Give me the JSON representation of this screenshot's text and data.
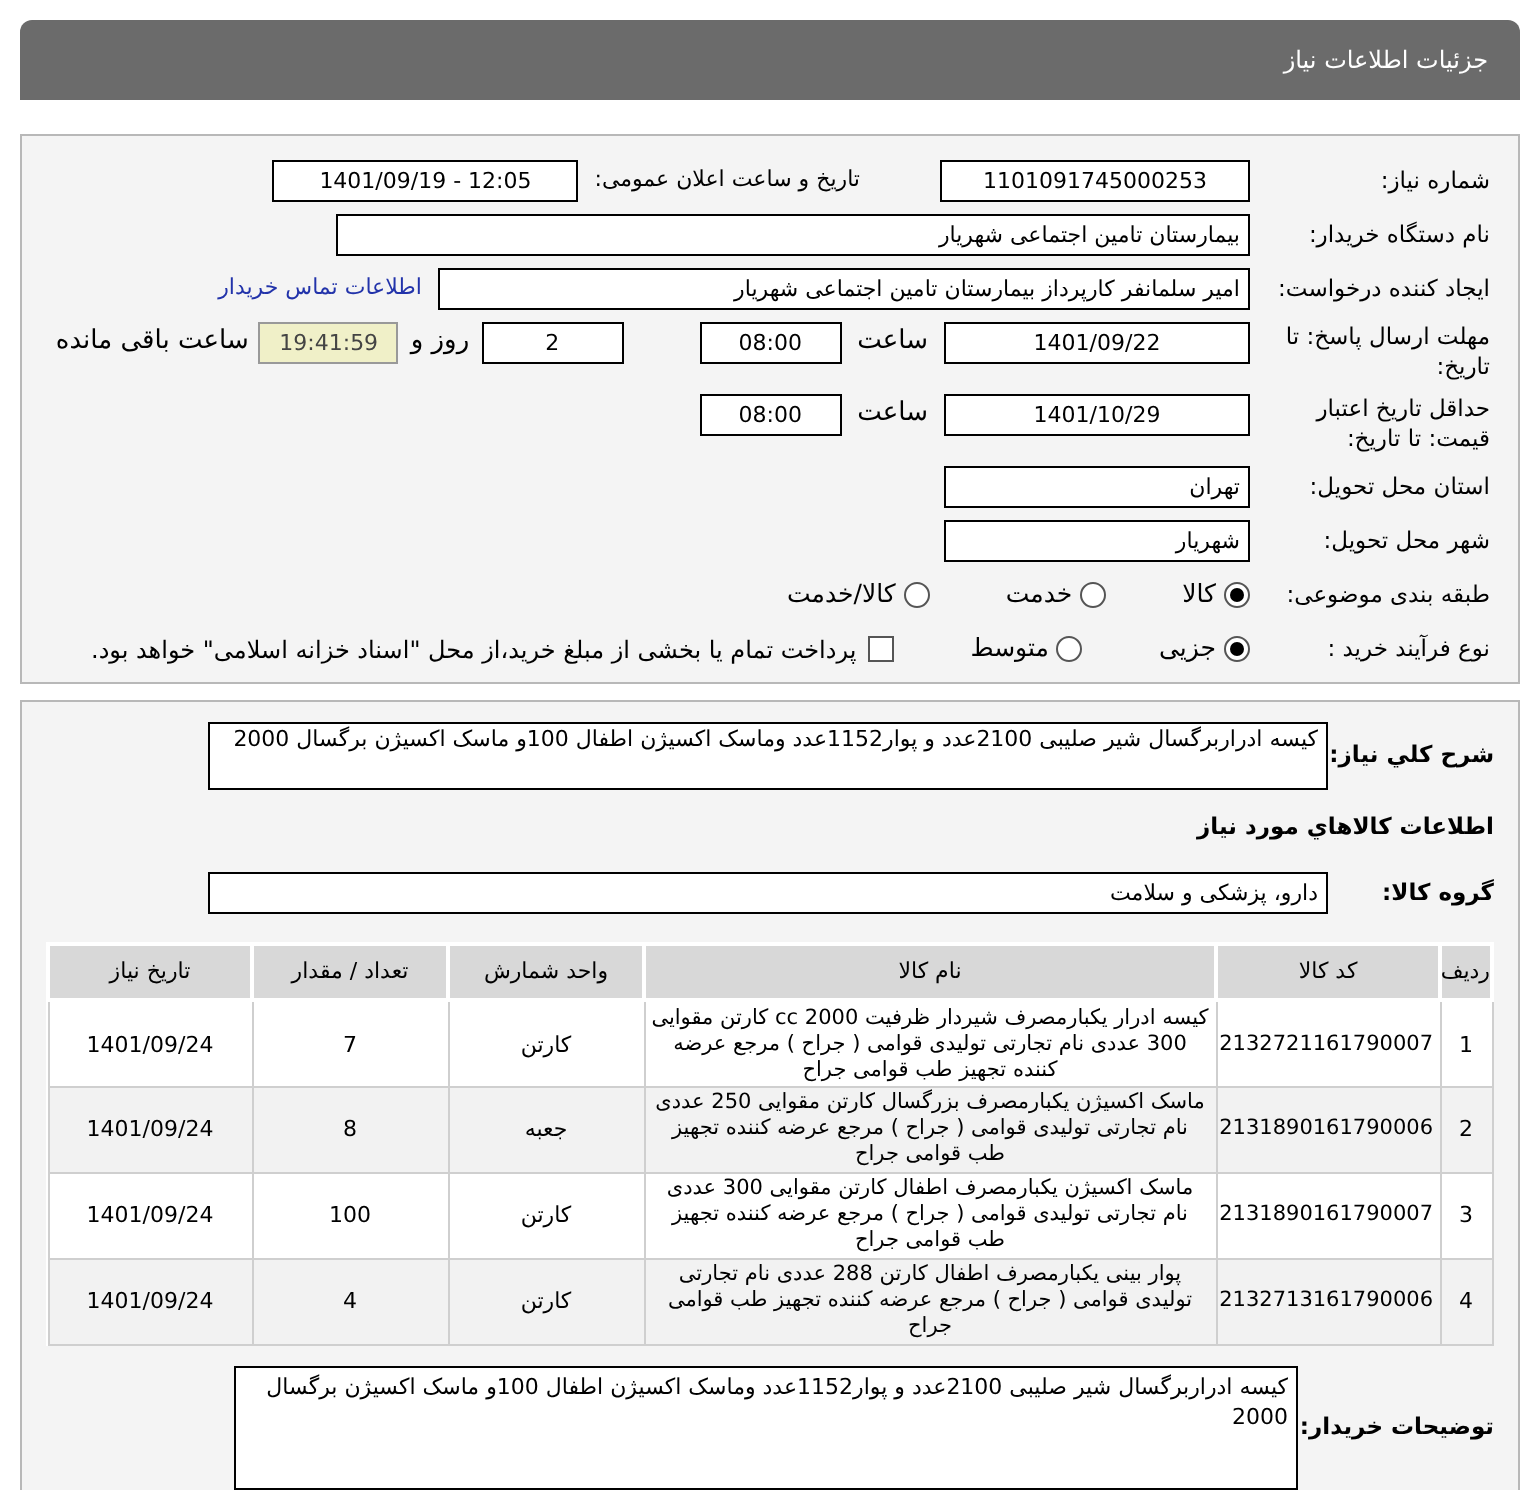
{
  "page_title": "جزئیات اطلاعات نیاز",
  "need_number": {
    "label": "شماره نیاز:",
    "value": "1101091745000253"
  },
  "announce": {
    "label": "تاریخ و ساعت اعلان عمومی:",
    "value": "1401/09/19 - 12:05"
  },
  "buyer_org": {
    "label": "نام دستگاه خریدار:",
    "value": "بیمارستان تامین اجتماعی شهریار"
  },
  "requester": {
    "label": "ایجاد کننده درخواست:",
    "value": "امیر سلمانفر کارپرداز بیمارستان تامین اجتماعی شهریار",
    "link": "اطلاعات تماس خریدار"
  },
  "deadline": {
    "label": "مهلت ارسال پاسخ: تا تاریخ:",
    "date": "1401/09/22",
    "time_label": "ساعت",
    "time": "08:00",
    "days": "2",
    "days_label": "روز و",
    "remaining": "19:41:59",
    "remaining_label": "ساعت باقی مانده"
  },
  "validity": {
    "label": "حداقل تاریخ اعتبار قیمت: تا تاریخ:",
    "date": "1401/10/29",
    "time_label": "ساعت",
    "time": "08:00"
  },
  "province": {
    "label": "استان محل تحویل:",
    "value": "تهران"
  },
  "city": {
    "label": "شهر محل تحویل:",
    "value": "شهریار"
  },
  "category": {
    "label": "طبقه بندی موضوعی:",
    "options": [
      {
        "label": "کالا",
        "selected": true
      },
      {
        "label": "خدمت",
        "selected": false
      },
      {
        "label": "کالا/خدمت",
        "selected": false
      }
    ]
  },
  "process": {
    "label": "نوع فرآیند خرید :",
    "options": [
      {
        "label": "جزیی",
        "selected": true
      },
      {
        "label": "متوسط",
        "selected": false
      }
    ],
    "treasury": {
      "label": "پرداخت تمام یا بخشی از مبلغ خرید،از محل \"اسناد خزانه اسلامی\" خواهد بود.",
      "checked": false
    }
  },
  "description": {
    "label": "شرح کلي نياز:",
    "value": "کیسه ادراربرگسال شیر صلیبی  2100عدد و پوار1152عدد وماسک اکسیژن اطفال 100و ماسک اکسیژن برگسال 2000"
  },
  "goods_heading": "اطلاعات كالاهاي مورد نياز",
  "goods_group": {
    "label": "گروه کالا:",
    "value": "دارو، پزشکی و سلامت"
  },
  "table": {
    "columns": [
      "ردیف",
      "کد کالا",
      "نام کالا",
      "واحد شمارش",
      "تعداد / مقدار",
      "تاریخ نیاز"
    ],
    "rows": [
      [
        "1",
        "2132721161790007",
        "کیسه ادرار یکبارمصرف شیردار ظرفیت cc 2000 کارتن مقوایی 300 عددی نام تجارتی تولیدی قوامی ( جراح ) مرجع عرضه کننده تجهیز طب قوامی جراح",
        "کارتن",
        "7",
        "1401/09/24"
      ],
      [
        "2",
        "2131890161790006",
        "ماسک اکسیژن یکبارمصرف بزرگسال کارتن مقوایی 250 عددی نام تجارتی تولیدی قوامی ( جراح ) مرجع عرضه کننده تجهیز طب قوامی جراح",
        "جعبه",
        "8",
        "1401/09/24"
      ],
      [
        "3",
        "2131890161790007",
        "ماسک اکسیژن یکبارمصرف اطفال کارتن مقوایی 300 عددی نام تجارتی تولیدی قوامی ( جراح ) مرجع عرضه کننده تجهیز طب قوامی جراح",
        "کارتن",
        "100",
        "1401/09/24"
      ],
      [
        "4",
        "2132713161790006",
        "پوار بینی یکبارمصرف اطفال کارتن 288 عددی نام تجارتی تولیدی قوامی ( جراح ) مرجع عرضه کننده تجهیز طب قوامی جراح",
        "کارتن",
        "4",
        "1401/09/24"
      ]
    ]
  },
  "buyer_notes": {
    "label": "توضیحات خریدار:",
    "value": "کیسه ادراربرگسال شیر صلیبی  2100عدد و پوار1152عدد وماسک اکسیژن اطفال 100و ماسک اکسیژن برگسال 2000"
  }
}
